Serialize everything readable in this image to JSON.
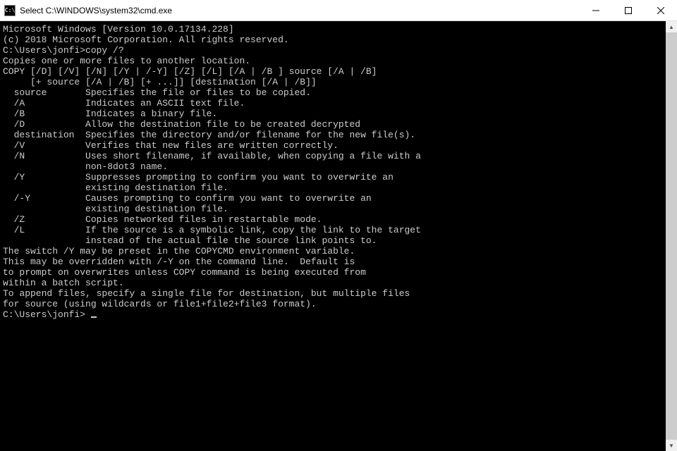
{
  "titlebar": {
    "icon_label": "C:\\",
    "title": "Select C:\\WINDOWS\\system32\\cmd.exe"
  },
  "terminal": {
    "lines": [
      "Microsoft Windows [Version 10.0.17134.228]",
      "(c) 2018 Microsoft Corporation. All rights reserved.",
      "",
      "C:\\Users\\jonfi>copy /?",
      "Copies one or more files to another location.",
      "",
      "COPY [/D] [/V] [/N] [/Y | /-Y] [/Z] [/L] [/A | /B ] source [/A | /B]",
      "     [+ source [/A | /B] [+ ...]] [destination [/A | /B]]",
      "",
      "  source       Specifies the file or files to be copied.",
      "  /A           Indicates an ASCII text file.",
      "  /B           Indicates a binary file.",
      "  /D           Allow the destination file to be created decrypted",
      "  destination  Specifies the directory and/or filename for the new file(s).",
      "  /V           Verifies that new files are written correctly.",
      "  /N           Uses short filename, if available, when copying a file with a",
      "               non-8dot3 name.",
      "  /Y           Suppresses prompting to confirm you want to overwrite an",
      "               existing destination file.",
      "  /-Y          Causes prompting to confirm you want to overwrite an",
      "               existing destination file.",
      "  /Z           Copies networked files in restartable mode.",
      "  /L           If the source is a symbolic link, copy the link to the target",
      "               instead of the actual file the source link points to.",
      "",
      "The switch /Y may be preset in the COPYCMD environment variable.",
      "This may be overridden with /-Y on the command line.  Default is",
      "to prompt on overwrites unless COPY command is being executed from",
      "within a batch script.",
      "",
      "To append files, specify a single file for destination, but multiple files",
      "for source (using wildcards or file1+file2+file3 format).",
      "",
      "C:\\Users\\jonfi> "
    ]
  }
}
